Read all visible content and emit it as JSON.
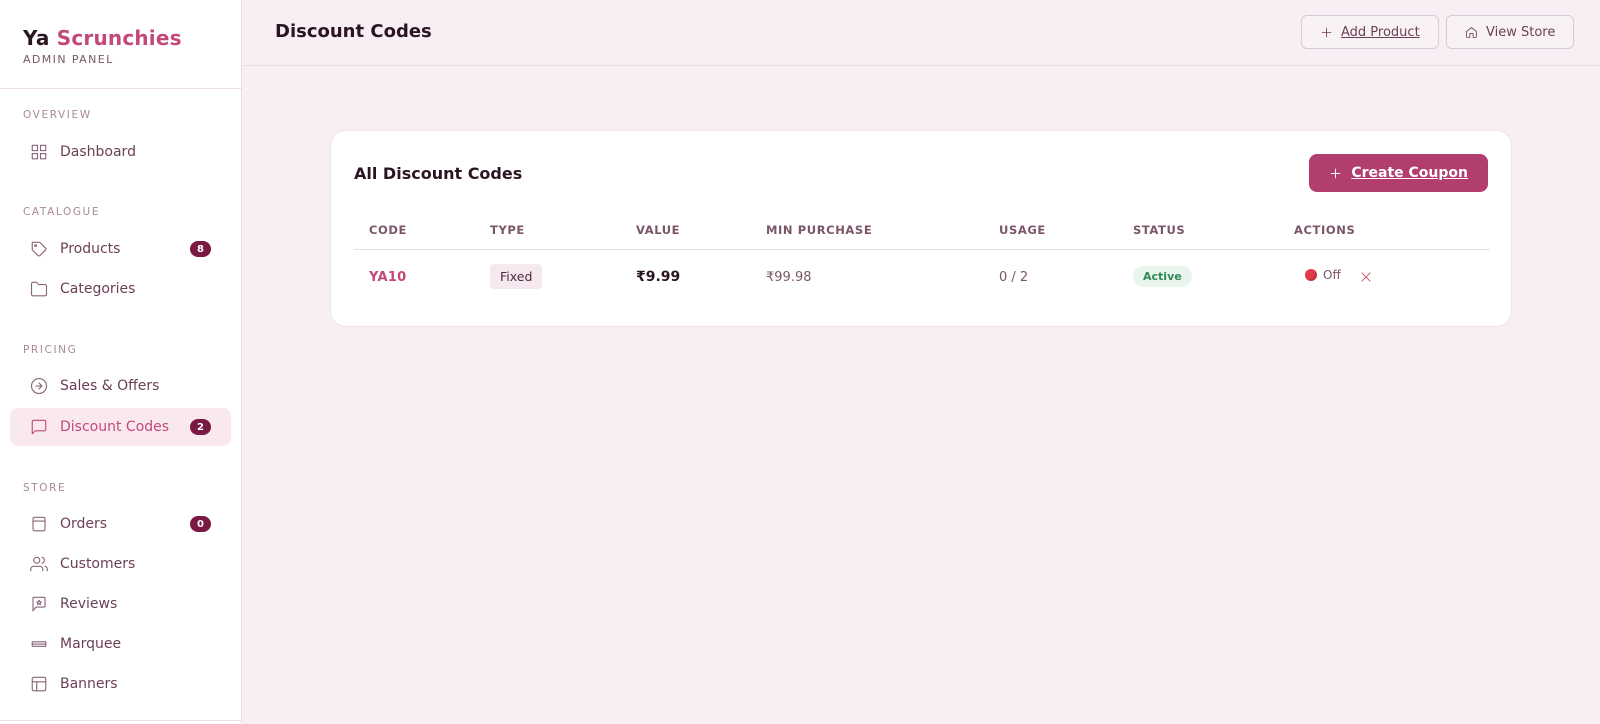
{
  "brand": {
    "name_part1": "Ya",
    "name_part2": "Scrunchies",
    "subtitle": "ADMIN PANEL"
  },
  "sidebar": {
    "sections": [
      {
        "label": "OVERVIEW"
      },
      {
        "label": "CATALOGUE"
      },
      {
        "label": "PRICING"
      },
      {
        "label": "STORE"
      }
    ],
    "items": [
      {
        "label": "Dashboard",
        "icon": "grid-icon"
      },
      {
        "label": "Products",
        "icon": "tag-icon",
        "badge": "8"
      },
      {
        "label": "Categories",
        "icon": "folder-icon"
      },
      {
        "label": "Sales & Offers",
        "icon": "arrow-circle-icon"
      },
      {
        "label": "Discount Codes",
        "icon": "message-square-icon",
        "badge": "2",
        "active": true
      },
      {
        "label": "Orders",
        "icon": "shopping-bag-icon",
        "badge": "0"
      },
      {
        "label": "Customers",
        "icon": "users-icon"
      },
      {
        "label": "Reviews",
        "icon": "review-icon"
      },
      {
        "label": "Marquee",
        "icon": "marquee-icon"
      },
      {
        "label": "Banners",
        "icon": "layout-icon"
      }
    ]
  },
  "header": {
    "title": "Discount Codes",
    "add_product_label": "Add Product",
    "view_store_label": "View Store"
  },
  "card": {
    "title": "All Discount Codes",
    "create_label": "Create Coupon",
    "columns": [
      "CODE",
      "TYPE",
      "VALUE",
      "MIN PURCHASE",
      "USAGE",
      "STATUS",
      "ACTIONS"
    ],
    "rows": [
      {
        "code": "YA10",
        "type": "Fixed",
        "value": "₹9.99",
        "min_purchase": "₹99.98",
        "usage": "0 / 2",
        "status": "Active",
        "toggle_label": "Off"
      }
    ]
  },
  "colors": {
    "accent": "#c2487a",
    "primary_button": "#b23e6f",
    "badge": "#7a1942",
    "status_active": "#2f8a55"
  }
}
